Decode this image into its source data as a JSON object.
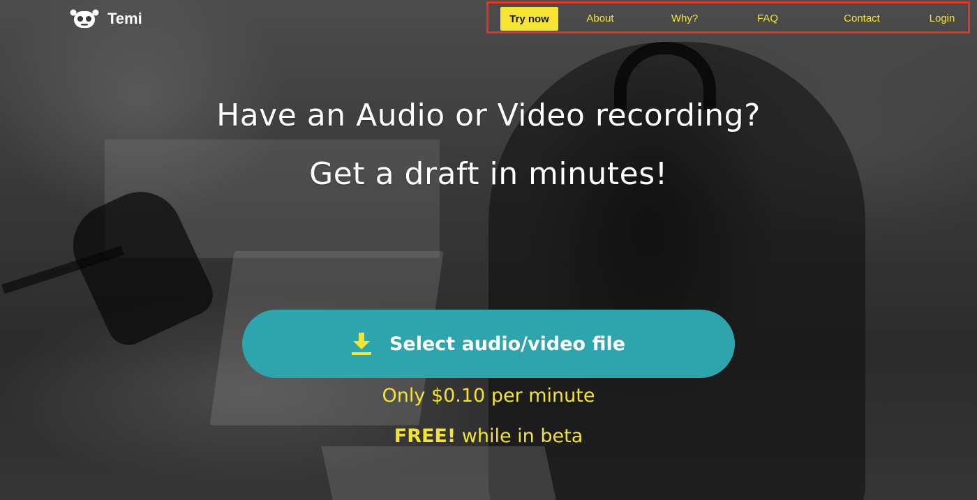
{
  "brand": {
    "name": "Temi",
    "logo_icon": "robot-face-icon"
  },
  "nav": {
    "items": [
      {
        "label": "Try now"
      },
      {
        "label": "About"
      },
      {
        "label": "Why?"
      },
      {
        "label": "FAQ"
      },
      {
        "label": "Contact"
      },
      {
        "label": "Login"
      }
    ]
  },
  "hero": {
    "headline_line1": "Have an Audio or Video recording?",
    "headline_line2": "Get a draft in minutes!",
    "cta": {
      "label": "Select audio/video file",
      "icon": "download-icon"
    },
    "price": "Only $0.10 per minute",
    "beta_strong": "FREE!",
    "beta_rest": " while in beta"
  },
  "colors": {
    "accent_yellow": "#f5e431",
    "cta_teal": "#2ea4ad",
    "highlight_red": "#e8321e"
  }
}
